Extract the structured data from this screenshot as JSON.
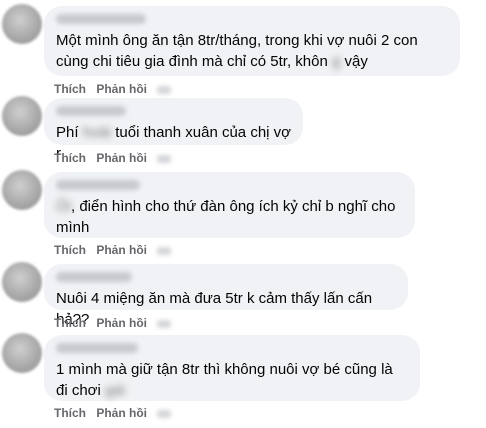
{
  "comments": [
    {
      "text_a": "Một mình ông ăn tận 8tr/tháng, trong khi vợ nuôi 2 con cùng chi tiêu gia đình mà chỉ có 5tr, khôn",
      "text_blur": "g",
      "text_b": "vậy",
      "like_label": "Thích",
      "reply_label": "Phản hồi"
    },
    {
      "text_a": "Phí",
      "text_blur": "hoài",
      "text_b": "tuổi thanh xuân của chị vợ r",
      "like_label": "Thích",
      "reply_label": "Phản hồi"
    },
    {
      "text_a": "",
      "text_blur": "Ôi",
      "text_b": ", điển hình cho thứ đàn ông ích kỷ chỉ b nghĩ cho mình",
      "like_label": "Thích",
      "reply_label": "Phản hồi"
    },
    {
      "text_a": "Nuôi 4 miệng ăn mà đưa 5tr k cảm thấy lấn cấn hả??",
      "text_blur": "",
      "text_b": "",
      "like_label": "Thích",
      "reply_label": "Phản hồi"
    },
    {
      "text_a": "1 mình mà giữ tận 8tr thì không nuôi vợ bé cũng là đi chơi",
      "text_blur": "gái",
      "text_b": "",
      "like_label": "Thích",
      "reply_label": "Phản hồi"
    }
  ]
}
